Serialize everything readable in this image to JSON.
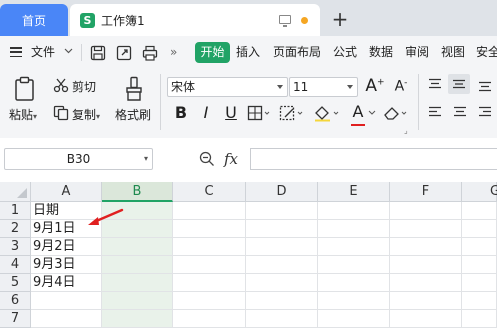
{
  "tabs": {
    "home_label": "首页",
    "doc_label": "工作簿1",
    "doc_logo": "S",
    "new_tab": "+"
  },
  "menu": {
    "file": "文件",
    "more": "»",
    "items": [
      "开始",
      "插入",
      "页面布局",
      "公式",
      "数据",
      "审阅",
      "视图",
      "安全"
    ]
  },
  "ribbon": {
    "paste": "粘贴",
    "cut": "剪切",
    "copy": "复制",
    "format_painter": "格式刷",
    "font_name": "宋体",
    "font_size": "11",
    "bold": "B",
    "italic": "I",
    "underline": "U",
    "font_color_letter": "A",
    "grow_font": "A",
    "shrink_font": "A"
  },
  "formula_bar": {
    "name_box": "B30",
    "fx": "fx",
    "formula": ""
  },
  "grid": {
    "columns": [
      "A",
      "B",
      "C",
      "D",
      "E",
      "F",
      "G"
    ],
    "active_column": "B",
    "rows": [
      "1",
      "2",
      "3",
      "4",
      "5",
      "6",
      "7"
    ],
    "cells": {
      "A1": "日期",
      "A2": "9月1日",
      "A3": "9月2日",
      "A4": "9月3日",
      "A5": "9月4日"
    }
  },
  "colors": {
    "accent_green": "#21a366",
    "home_tab_blue": "#4a86f7",
    "annotation_red": "#e02020"
  }
}
